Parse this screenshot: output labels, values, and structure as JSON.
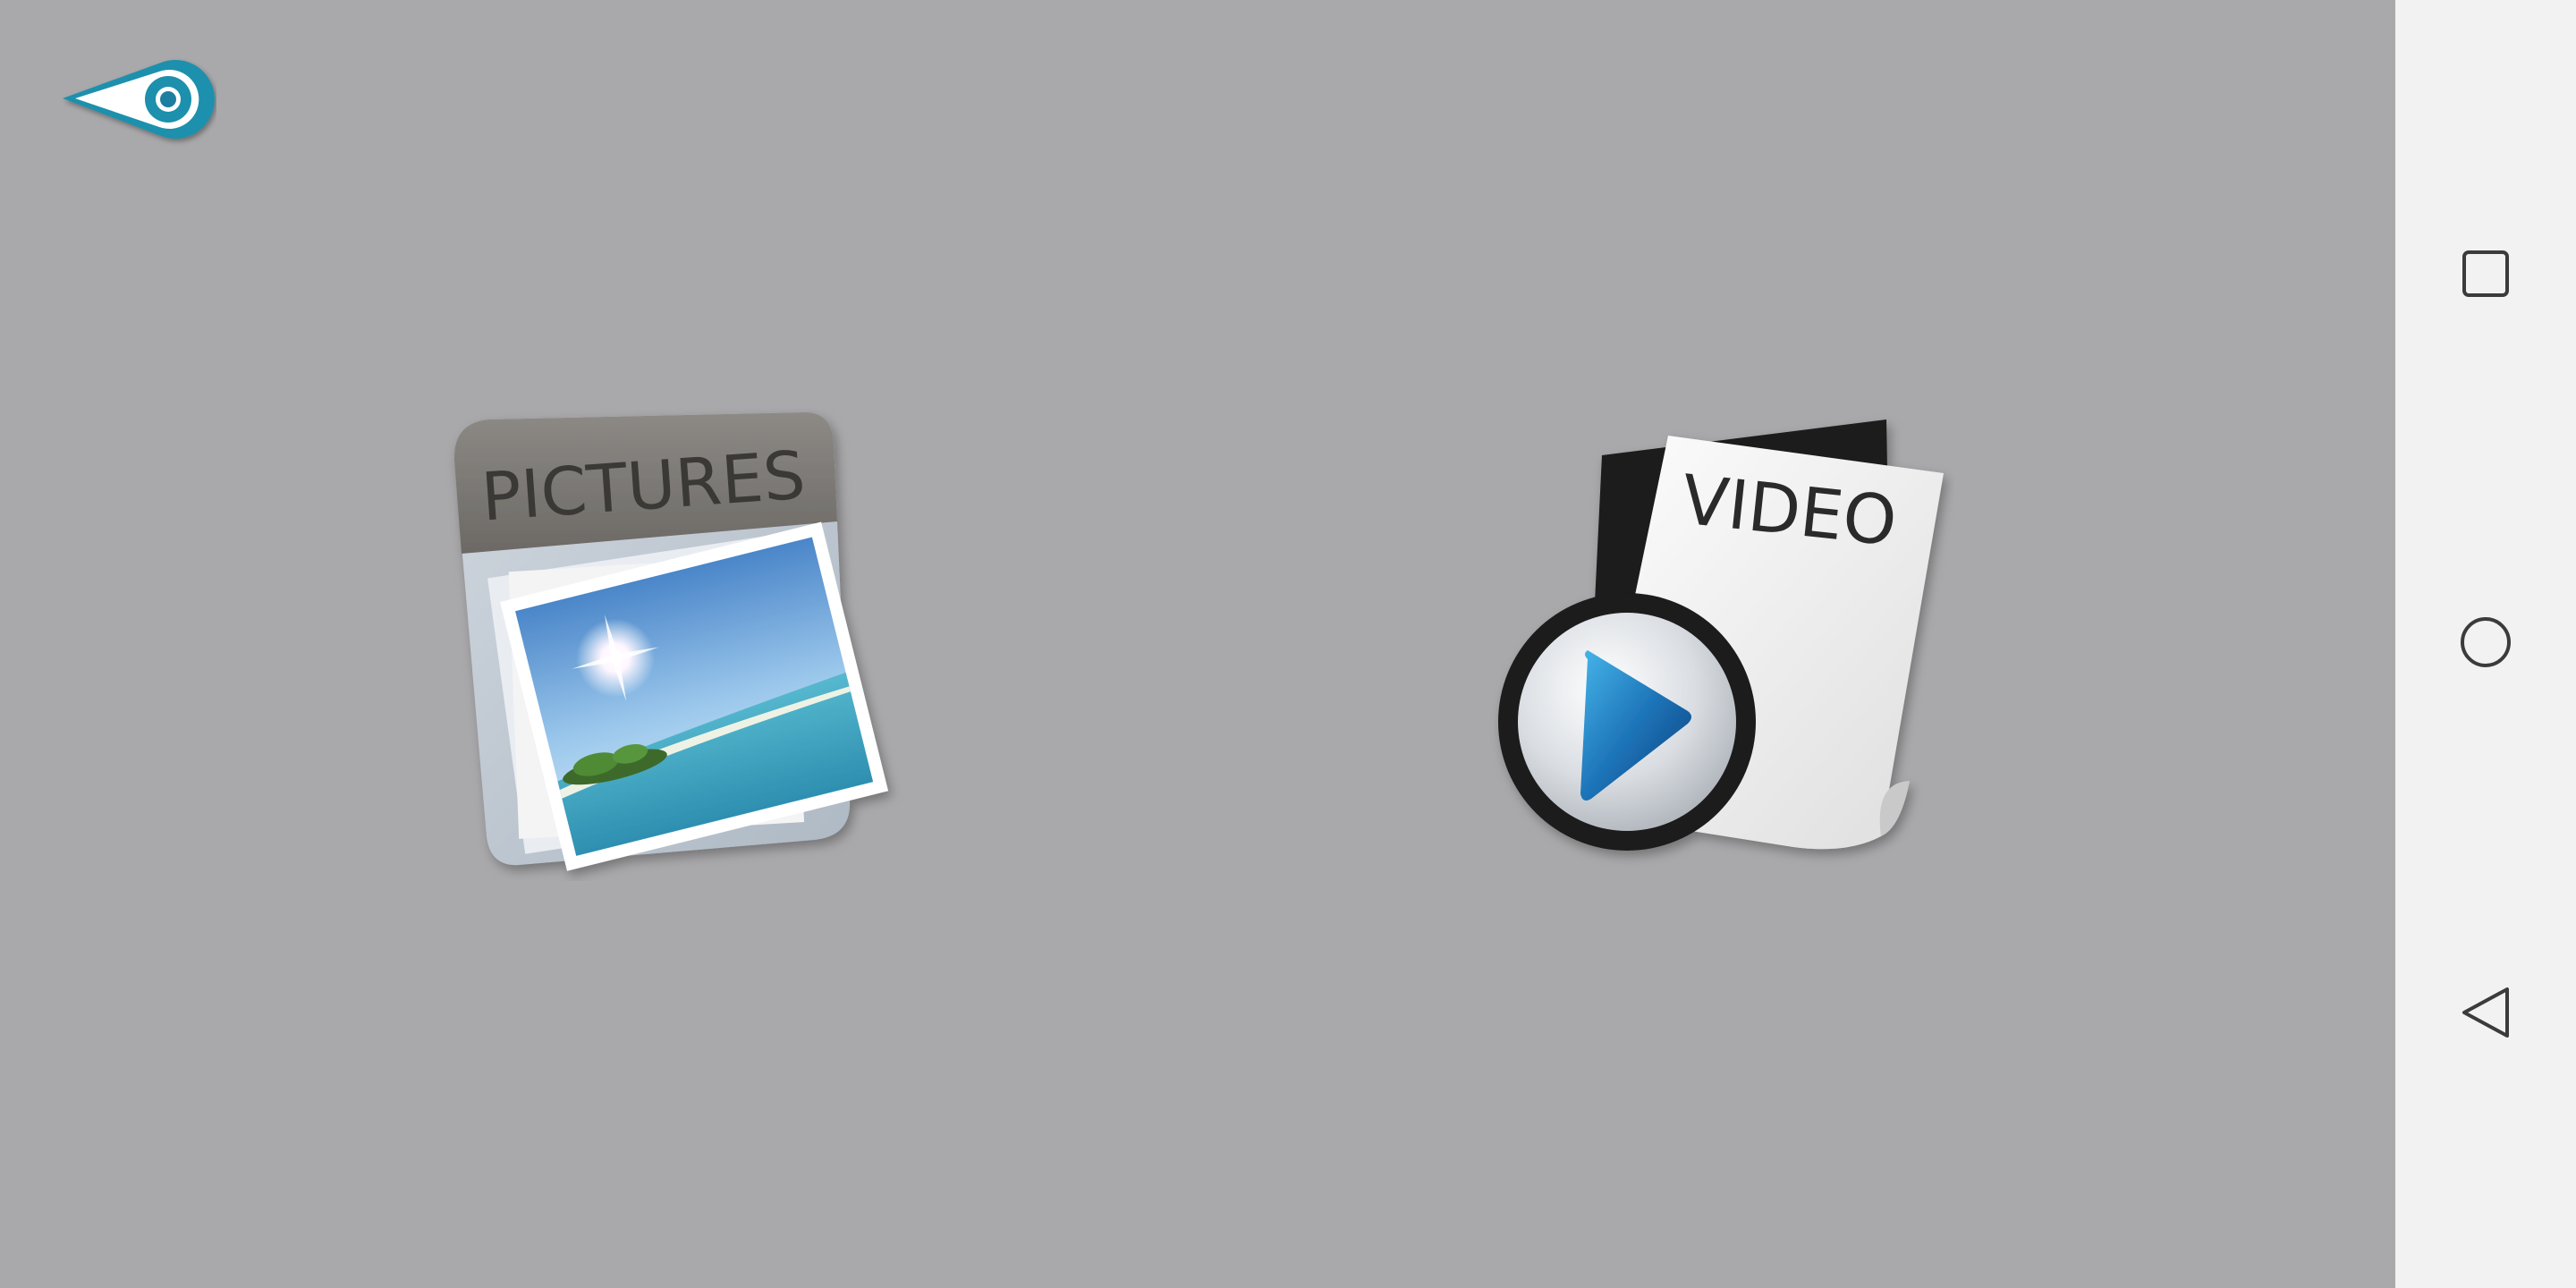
{
  "pictures_tile": {
    "label": "PICTURES"
  },
  "video_tile": {
    "label": "VIDEO"
  },
  "colors": {
    "content_background": "#a9a8aa",
    "navbar_background": "#f2f2f2",
    "back_button_accent": "#1e90ad",
    "play_button_blue": "#1d74b8"
  },
  "icons": {
    "back": "back-eye-icon",
    "pictures": "pictures-folder-icon",
    "video": "video-file-icon",
    "play": "play-icon",
    "nav_square": "recent-apps-icon",
    "nav_home": "home-icon",
    "nav_back": "back-triangle-icon"
  }
}
